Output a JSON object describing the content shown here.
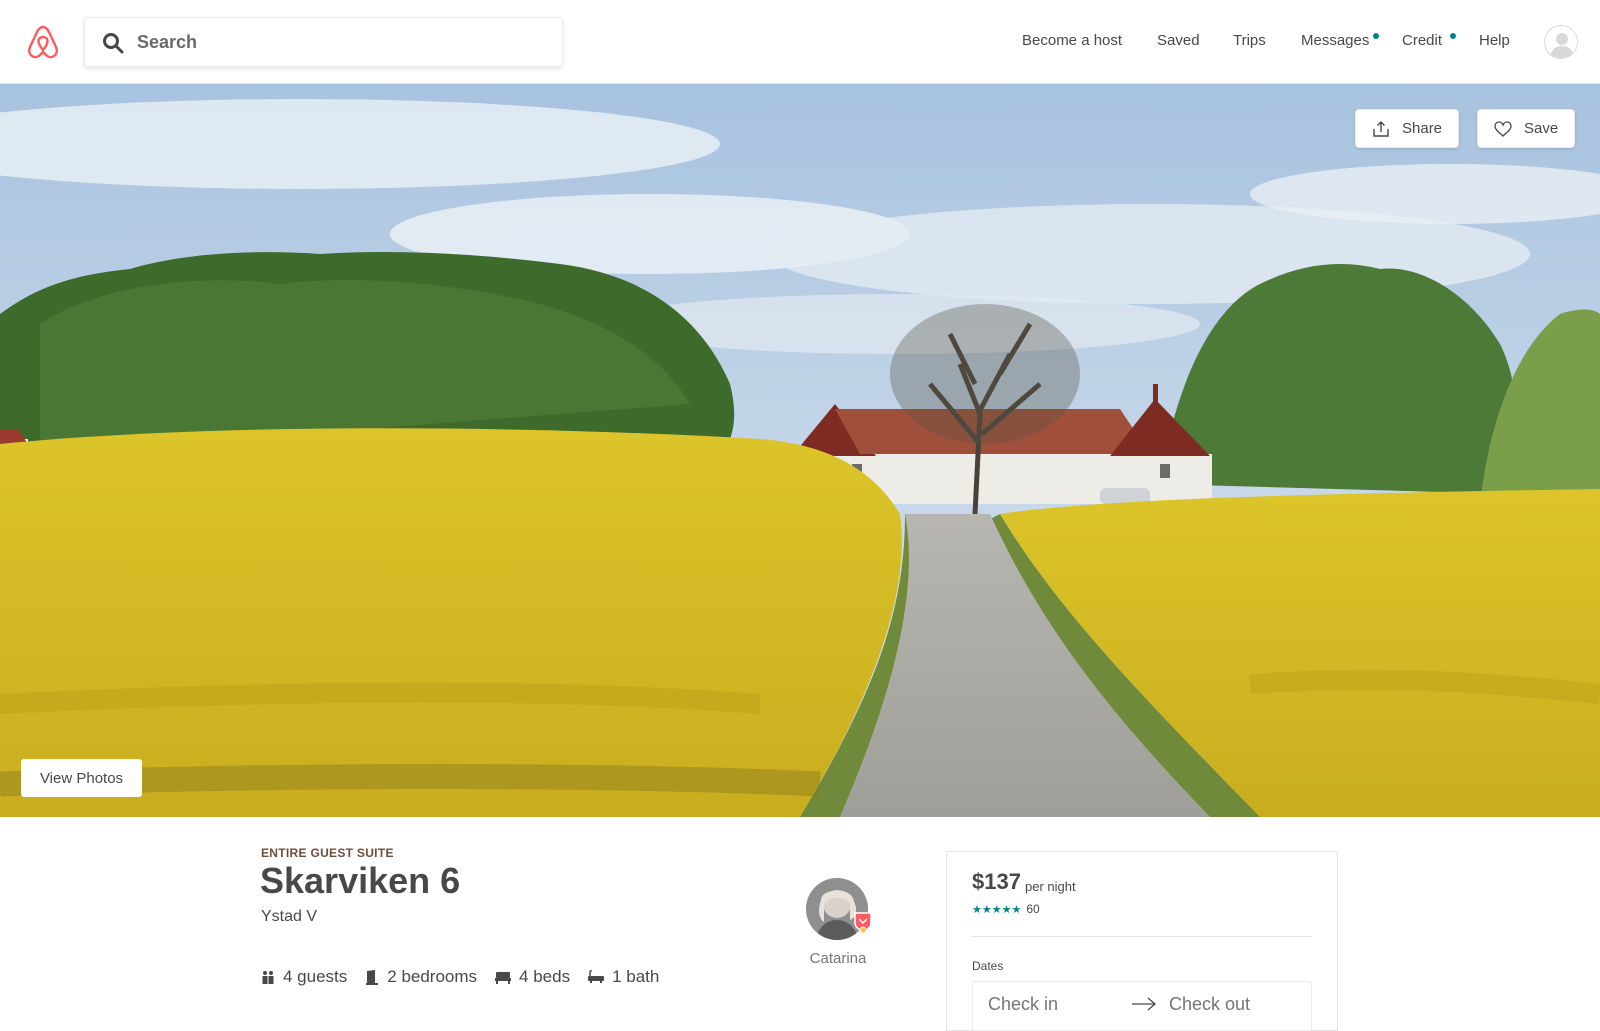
{
  "header": {
    "logo_icon": "airbnb-belo-icon",
    "brand_color": "#ff5a5f",
    "search": {
      "placeholder": "Search",
      "value": ""
    },
    "nav": {
      "become_host": "Become a host",
      "saved": "Saved",
      "trips": "Trips",
      "messages": "Messages",
      "credit": "Credit",
      "help": "Help"
    },
    "notification_dot_color": "#008489"
  },
  "hero": {
    "share_label": "Share",
    "save_label": "Save",
    "view_photos_label": "View Photos"
  },
  "listing": {
    "kind": "ENTIRE GUEST SUITE",
    "title": "Skarviken 6",
    "location": "Ystad V",
    "amenities": {
      "guests": "4 guests",
      "bedrooms": "2 bedrooms",
      "beds": "4 beds",
      "baths": "1 bath"
    },
    "host": {
      "name": "Catarina"
    }
  },
  "booking": {
    "price": "$137",
    "per_night": "per night",
    "rating_stars": "★★★★★",
    "review_count": "60",
    "dates_label": "Dates",
    "check_in": "Check in",
    "check_out": "Check out"
  }
}
